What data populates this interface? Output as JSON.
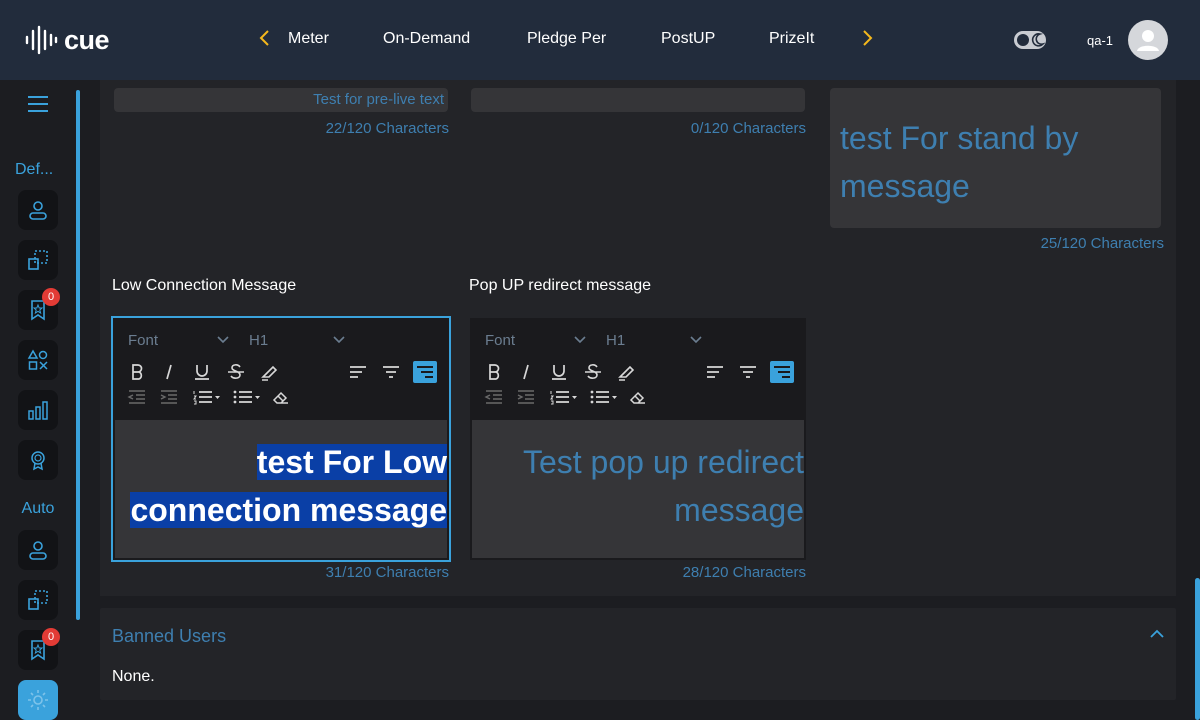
{
  "header": {
    "logo_text": "cue",
    "nav_items": [
      "Meter",
      "On-Demand",
      "Pledge Per",
      "PostUP",
      "PrizeIt"
    ],
    "username": "qa-1",
    "accent_color": "#f5b81c"
  },
  "sidebar": {
    "section_default": "Def...",
    "section_auto": "Auto",
    "badge_count_1": "0",
    "badge_count_2": "0"
  },
  "fields": {
    "prelive": {
      "value": "Test for pre-live text",
      "count": "22/120 Characters"
    },
    "middle_top": {
      "value": "",
      "count": "0/120 Characters"
    },
    "standby": {
      "value": "test For stand by message",
      "count": "25/120 Characters"
    },
    "low_connection": {
      "label": "Low Connection Message",
      "font_select": "Font",
      "heading_select": "H1",
      "line1": "test For Low",
      "line2": "connection message",
      "count": "31/120 Characters"
    },
    "popup_redirect": {
      "label": "Pop UP redirect message",
      "font_select": "Font",
      "heading_select": "H1",
      "line1": "Test pop up redirect",
      "line2": "message",
      "count": "28/120 Characters"
    }
  },
  "banned_users": {
    "title": "Banned Users",
    "value": "None."
  }
}
